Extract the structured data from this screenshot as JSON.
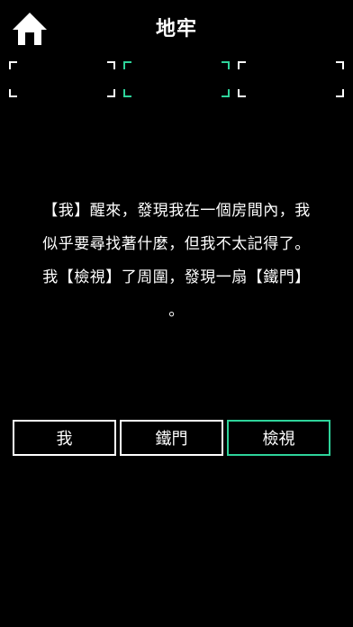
{
  "header": {
    "title": "地牢",
    "home_icon": "home-icon"
  },
  "slots": [
    {
      "name": "inventory-slot-1",
      "selected": false
    },
    {
      "name": "inventory-slot-2",
      "selected": true
    },
    {
      "name": "inventory-slot-3",
      "selected": false
    }
  ],
  "story": {
    "lines": [
      "【我】醒來，發現我在一個房間內，我",
      "似乎要尋找著什麼，但我不太記得了。",
      "我【檢視】了周圍，發現一扇【鐵門】",
      "。"
    ]
  },
  "choices": [
    {
      "label": "我",
      "active": false
    },
    {
      "label": "鐵門",
      "active": false
    },
    {
      "label": "檢視",
      "active": true
    }
  ],
  "colors": {
    "background": "#000000",
    "text": "#ffffff",
    "accent": "#2ed39a"
  }
}
